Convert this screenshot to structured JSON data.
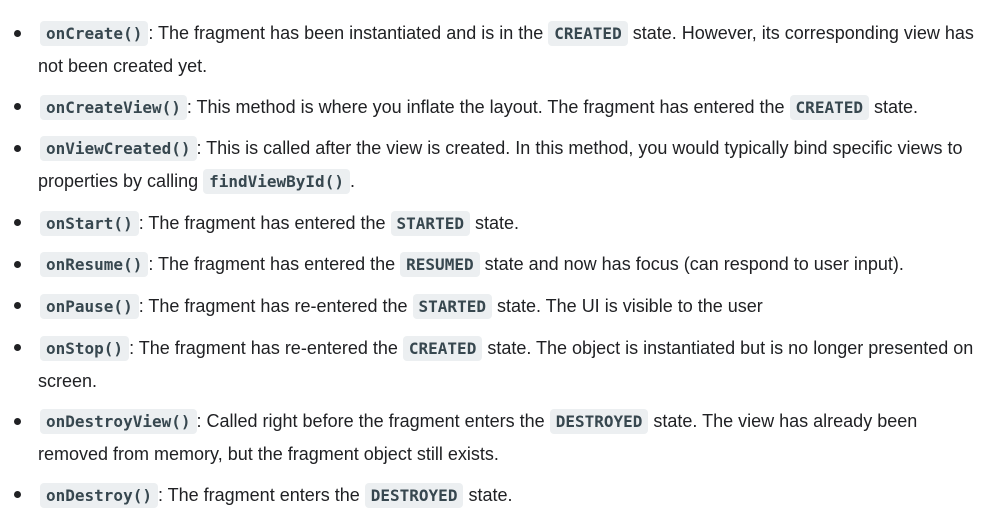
{
  "items": [
    {
      "method": "onCreate()",
      "parts": [
        {
          "type": "text",
          "value": ": The fragment has been instantiated and is in the "
        },
        {
          "type": "code",
          "value": "CREATED"
        },
        {
          "type": "text",
          "value": " state. However, its corresponding view has not been created yet."
        }
      ]
    },
    {
      "method": "onCreateView()",
      "parts": [
        {
          "type": "text",
          "value": ": This method is where you inflate the layout. The fragment has entered the "
        },
        {
          "type": "code",
          "value": "CREATED"
        },
        {
          "type": "text",
          "value": " state."
        }
      ]
    },
    {
      "method": "onViewCreated()",
      "parts": [
        {
          "type": "text",
          "value": ": This is called after the view is created. In this method, you would typically bind specific views to properties by calling "
        },
        {
          "type": "code",
          "value": "findViewById()"
        },
        {
          "type": "text",
          "value": "."
        }
      ]
    },
    {
      "method": "onStart()",
      "parts": [
        {
          "type": "text",
          "value": ": The fragment has entered the "
        },
        {
          "type": "code",
          "value": "STARTED"
        },
        {
          "type": "text",
          "value": " state."
        }
      ]
    },
    {
      "method": "onResume()",
      "parts": [
        {
          "type": "text",
          "value": ": The fragment has entered the "
        },
        {
          "type": "code",
          "value": "RESUMED"
        },
        {
          "type": "text",
          "value": " state and now has focus (can respond to user input)."
        }
      ]
    },
    {
      "method": "onPause()",
      "parts": [
        {
          "type": "text",
          "value": ": The fragment has re-entered the "
        },
        {
          "type": "code",
          "value": "STARTED"
        },
        {
          "type": "text",
          "value": " state. The UI is visible to the user"
        }
      ]
    },
    {
      "method": "onStop()",
      "parts": [
        {
          "type": "text",
          "value": ": The fragment has re-entered the "
        },
        {
          "type": "code",
          "value": "CREATED"
        },
        {
          "type": "text",
          "value": " state. The object is instantiated but is no longer presented on screen."
        }
      ]
    },
    {
      "method": "onDestroyView()",
      "parts": [
        {
          "type": "text",
          "value": ": Called right before the fragment enters the "
        },
        {
          "type": "code",
          "value": "DESTROYED"
        },
        {
          "type": "text",
          "value": " state. The view has already been removed from memory, but the fragment object still exists."
        }
      ]
    },
    {
      "method": "onDestroy()",
      "parts": [
        {
          "type": "text",
          "value": ": The fragment enters the "
        },
        {
          "type": "code",
          "value": "DESTROYED"
        },
        {
          "type": "text",
          "value": " state."
        }
      ]
    }
  ]
}
